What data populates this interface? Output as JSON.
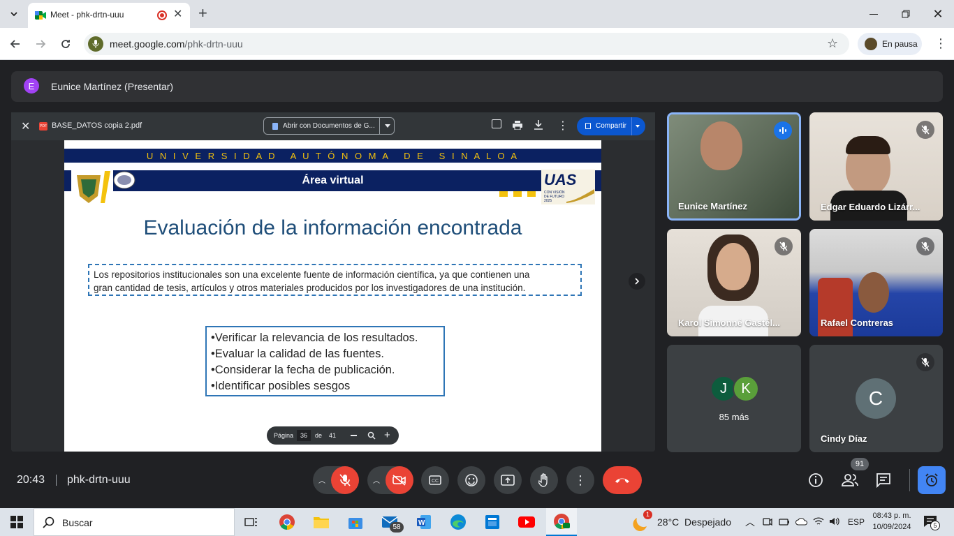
{
  "browser": {
    "tab_title": "Meet - phk-drtn-uuu",
    "url_domain": "meet.google.com",
    "url_path": "/phk-drtn-uuu",
    "profile_label": "En pausa"
  },
  "meet": {
    "presenter_initial": "E",
    "presenter_label": "Eunice Martínez (Presentar)",
    "meeting_time": "20:43",
    "meeting_code": "phk-drtn-uuu",
    "people_count": "91"
  },
  "pdf": {
    "filename": "BASE_DATOS copia 2.pdf",
    "open_with_label": "Abrir con Documentos de G...",
    "share_label": "Compartir",
    "page_label": "Página",
    "page_current": "36",
    "page_of": "de",
    "page_total": "41"
  },
  "slide": {
    "university_banner": "U N I V E R S I D A D   A U T Ó N O M A   D E   S I N A L O A",
    "section_title": "Área virtual",
    "uas_logo_text": "UAS",
    "uas_logo_sub": "CON VISIÓN DE FUTURO 2025",
    "heading": "Evaluación de la información encontrada",
    "paragraph_line1": "Los repositorios institucionales son una excelente fuente de información científica, ya que contienen una",
    "paragraph_line2": "gran cantidad de tesis, artículos y otros materiales producidos por los investigadores de una institución.",
    "bullets": [
      "•Verificar la relevancia de los resultados.",
      "•Evaluar la calidad de las fuentes.",
      "•Considerar la fecha de publicación.",
      "•Identificar posibles sesgos"
    ]
  },
  "participants": {
    "p1": "Eunice Martínez",
    "p2": "Edgar Eduardo Lizárr...",
    "p3": "Karol Simonné Gastél...",
    "p4": "Rafael Contreras",
    "more_initial_1": "J",
    "more_initial_2": "K",
    "more_label": "85 más",
    "p6_initial": "C",
    "p6": "Cindy Díaz"
  },
  "taskbar": {
    "search_label": "Buscar",
    "mail_badge": "58",
    "weather_badge": "1",
    "weather": "28°C  Despejado",
    "language": "ESP",
    "time": "08:43 p. m.",
    "date": "10/09/2024",
    "notification_count": "5"
  },
  "colors": {
    "meet_bg": "#202124",
    "tile_bg": "#3c4043",
    "active_speaker": "#8ab4f8",
    "end_call": "#ea4335",
    "uas_navy": "#0b2161",
    "uas_gold": "#f4c20d",
    "slide_heading": "#1f4e79",
    "activities_blue": "#4285f4"
  }
}
